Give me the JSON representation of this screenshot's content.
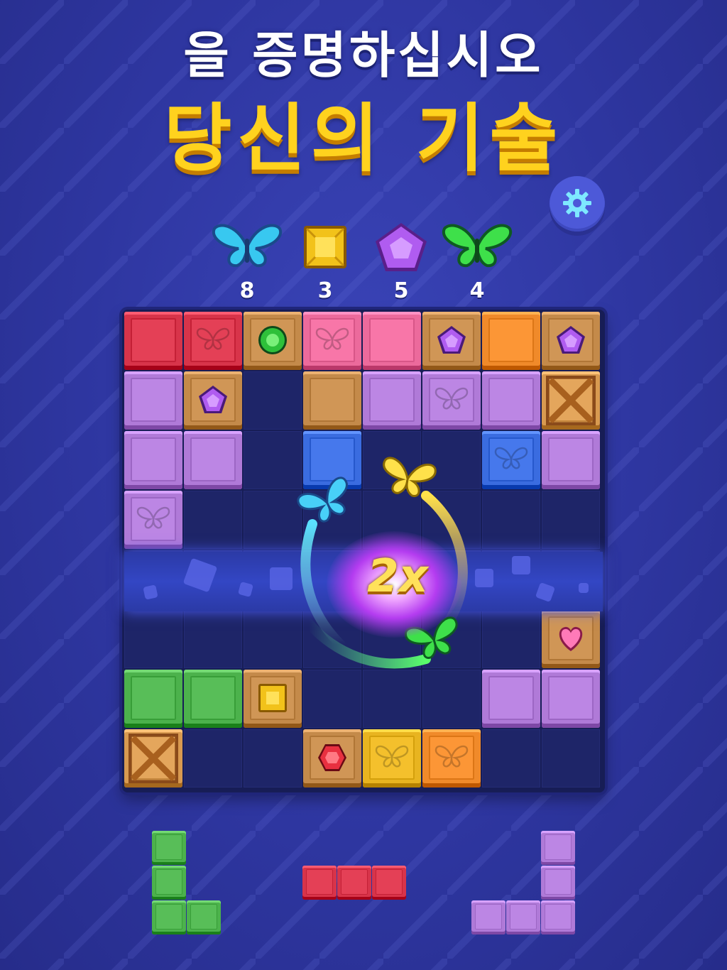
{
  "header": {
    "line1": "을 증명하십시오",
    "line2": "당신의 기술"
  },
  "settings": {
    "icon": "gear-icon"
  },
  "goals": [
    {
      "name": "blue-butterfly",
      "count": "8",
      "color": "#38c8f0"
    },
    {
      "name": "yellow-gem",
      "count": "3",
      "color": "#f2c21a"
    },
    {
      "name": "purple-gem",
      "count": "5",
      "color": "#b05cf0"
    },
    {
      "name": "green-butterfly",
      "count": "4",
      "color": "#3ee04a"
    }
  ],
  "multiplier": "2x",
  "colors": {
    "red": "#d8344a",
    "pink": "#ec6a9c",
    "purple": "#b07ad8",
    "orange": "#f08a2a",
    "wood": "#c48a4a",
    "blue": "#3a6ce0",
    "green": "#4cb24c",
    "yellow": "#e8b420"
  },
  "board": {
    "rows": [
      [
        "red",
        "red-butterfly",
        "wood-green-gem",
        "pink-butterfly",
        "pink",
        "wood-purple-gem",
        "orange",
        "wood-purple-gem"
      ],
      [
        "purple",
        "wood-purple-gem",
        "",
        "wood",
        "purple",
        "purple-butterfly",
        "purple",
        "crate"
      ],
      [
        "purple",
        "purple",
        "",
        "blue",
        "",
        "",
        "blue-butterfly",
        "purple"
      ],
      [
        "purple-butterfly",
        "",
        "",
        "",
        "",
        "",
        "",
        ""
      ],
      [
        "",
        "",
        "",
        "",
        "",
        "",
        "",
        ""
      ],
      [
        "",
        "",
        "",
        "",
        "",
        "",
        "",
        "wood-heart"
      ],
      [
        "green",
        "green",
        "wood-yellow-gem",
        "",
        "",
        "",
        "purple",
        "purple"
      ],
      [
        "crate",
        "",
        "",
        "wood-red-gem",
        "yellow-butterfly",
        "orange-butterfly",
        "",
        ""
      ]
    ]
  },
  "pieces": [
    {
      "name": "green-l-piece",
      "color": "green"
    },
    {
      "name": "red-bar-piece",
      "color": "red"
    },
    {
      "name": "purple-j-piece",
      "color": "purple"
    }
  ]
}
